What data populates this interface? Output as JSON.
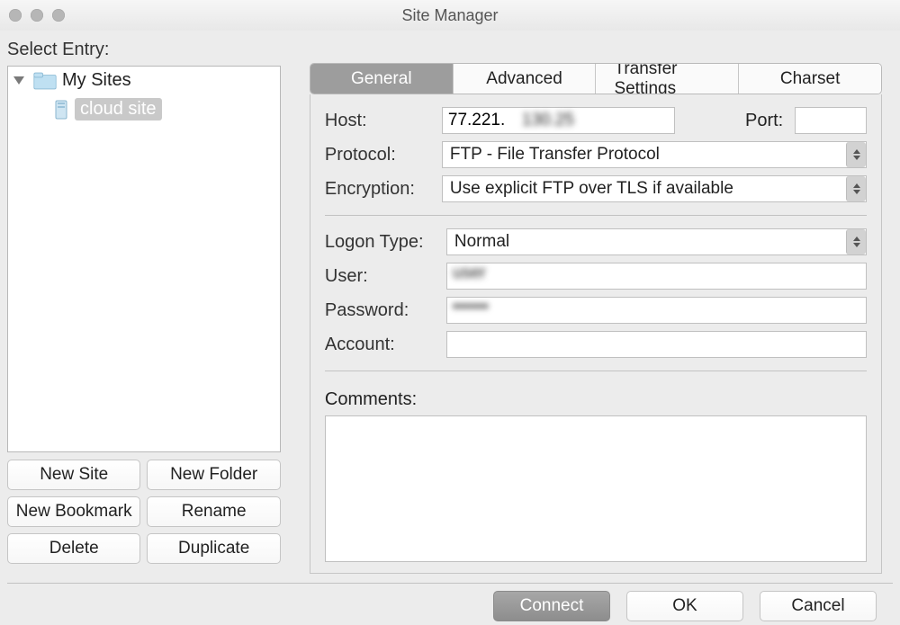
{
  "window": {
    "title": "Site Manager"
  },
  "left": {
    "select_label": "Select Entry:",
    "tree": {
      "root_label": "My Sites",
      "site_label": "cloud site"
    },
    "buttons": {
      "new_site": "New Site",
      "new_folder": "New Folder",
      "new_bookmark": "New Bookmark",
      "rename": "Rename",
      "delete": "Delete",
      "duplicate": "Duplicate"
    }
  },
  "tabs": {
    "general": "General",
    "advanced": "Advanced",
    "transfer": "Transfer Settings",
    "charset": "Charset"
  },
  "form": {
    "host_label": "Host:",
    "host_value": "77.221.130.25",
    "port_label": "Port:",
    "port_value": "",
    "protocol_label": "Protocol:",
    "protocol_value": "FTP - File Transfer Protocol",
    "encryption_label": "Encryption:",
    "encryption_value": "Use explicit FTP over TLS if available",
    "logon_label": "Logon Type:",
    "logon_value": "Normal",
    "user_label": "User:",
    "user_value": "user",
    "password_label": "Password:",
    "password_value": "••••••",
    "account_label": "Account:",
    "account_value": "",
    "comments_label": "Comments:",
    "comments_value": ""
  },
  "footer": {
    "connect": "Connect",
    "ok": "OK",
    "cancel": "Cancel"
  }
}
